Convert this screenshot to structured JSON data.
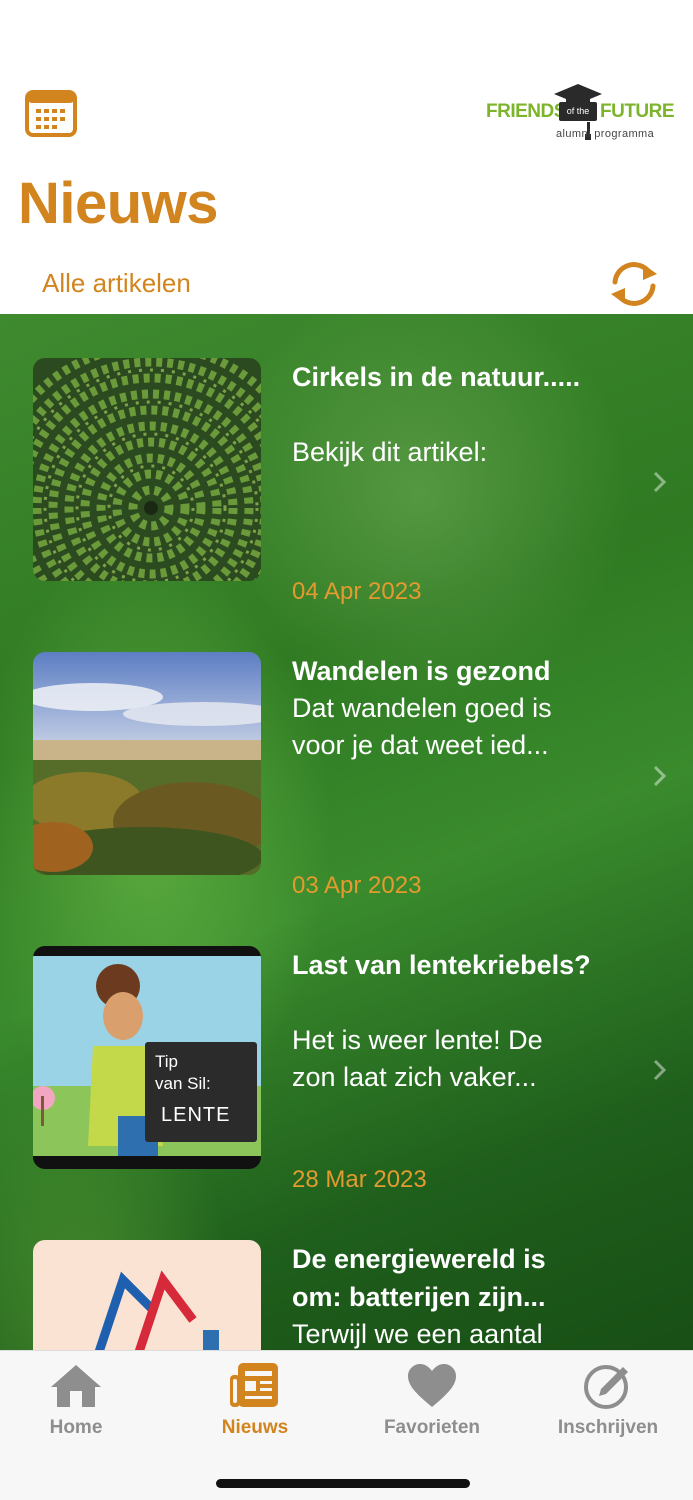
{
  "header": {
    "logo": {
      "left": "FRIENDS",
      "middle": "of the",
      "right": "FUTURE",
      "sub": "alumni programma"
    },
    "title": "Nieuws",
    "filter_label": "Alle artikelen"
  },
  "articles": [
    {
      "title": "Cirkels in de natuur.....",
      "description": "Bekijk dit artikel:",
      "date": "04 Apr 2023"
    },
    {
      "title": "Wandelen is gezond",
      "description": "Dat wandelen goed is voor je dat weet ied...",
      "date": "03 Apr 2023"
    },
    {
      "title": "Last van lentekriebels?",
      "description": "Het is weer lente! De zon laat zich vaker...",
      "date": "28 Mar 2023",
      "thumb_sign": {
        "line1": "Tip",
        "line2": "van Sil:",
        "line3": "LENTE"
      }
    },
    {
      "title": "De energiewereld is om: batterijen zijn...",
      "description": "Terwijl we een aantal",
      "date": ""
    }
  ],
  "tabbar": {
    "tabs": [
      {
        "label": "Home",
        "icon": "home-icon"
      },
      {
        "label": "Nieuws",
        "icon": "newspaper-icon",
        "active": true
      },
      {
        "label": "Favorieten",
        "icon": "heart-icon"
      },
      {
        "label": "Inschrijven",
        "icon": "edit-circle-icon"
      }
    ]
  },
  "colors": {
    "accent": "#d2841f",
    "logo_green": "#7cb42b",
    "date": "#e39a2e"
  }
}
